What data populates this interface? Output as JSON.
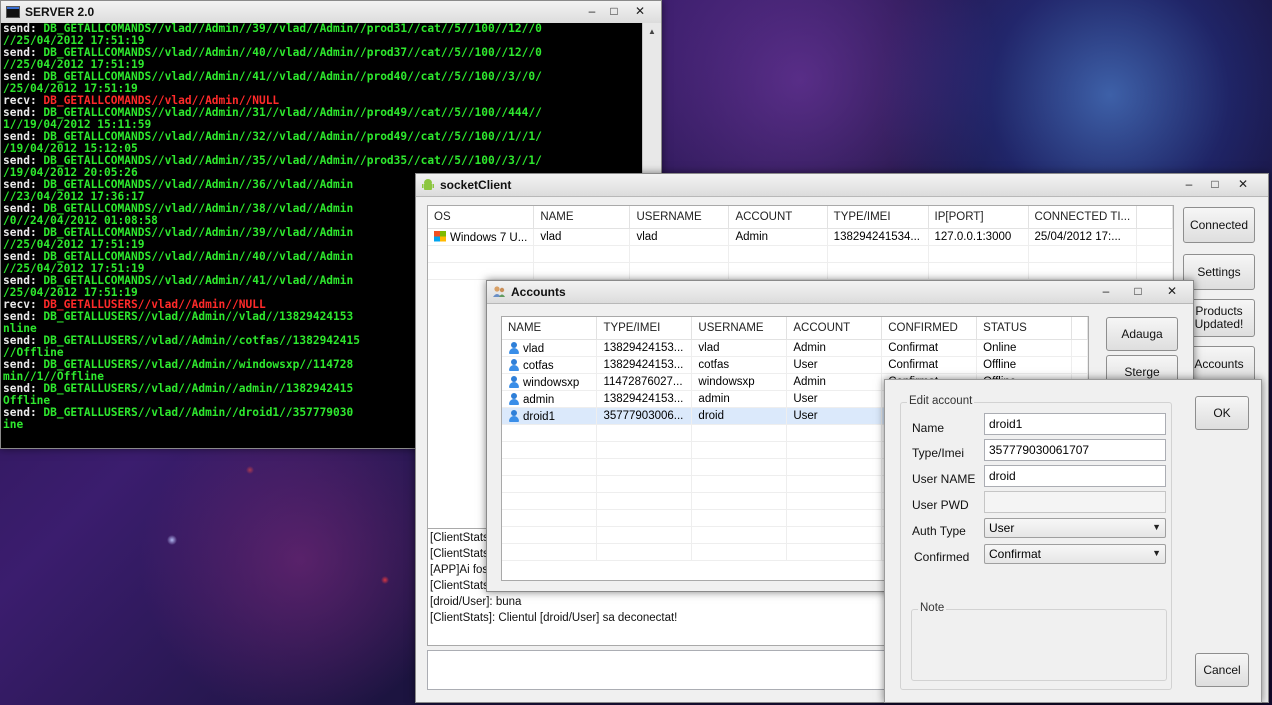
{
  "server": {
    "title": "SERVER 2.0",
    "lines": [
      {
        "lbl": "send:",
        "text": " DB_GETALLCOMANDS//vlad//Admin//39//vlad//Admin//prod31//cat//5//100//12//0",
        "kind": "green"
      },
      {
        "lbl": "",
        "text": "//25/04/2012 17:51:19",
        "kind": "green"
      },
      {
        "lbl": "send:",
        "text": " DB_GETALLCOMANDS//vlad//Admin//40//vlad//Admin//prod37//cat//5//100//12//0",
        "kind": "green"
      },
      {
        "lbl": "",
        "text": "//25/04/2012 17:51:19",
        "kind": "green"
      },
      {
        "lbl": "send:",
        "text": " DB_GETALLCOMANDS//vlad//Admin//41//vlad//Admin//prod40//cat//5//100//3//0/",
        "kind": "green"
      },
      {
        "lbl": "",
        "text": "/25/04/2012 17:51:19",
        "kind": "green"
      },
      {
        "lbl": "recv:",
        "text": " DB_GETALLCOMANDS//vlad//Admin//NULL",
        "kind": "red"
      },
      {
        "lbl": "send:",
        "text": " DB_GETALLCOMANDS//vlad//Admin//31//vlad//Admin//prod49//cat//5//100//444//",
        "kind": "green"
      },
      {
        "lbl": "",
        "text": "1//19/04/2012 15:11:59",
        "kind": "green"
      },
      {
        "lbl": "send:",
        "text": " DB_GETALLCOMANDS//vlad//Admin//32//vlad//Admin//prod49//cat//5//100//1//1/",
        "kind": "green"
      },
      {
        "lbl": "",
        "text": "/19/04/2012 15:12:05",
        "kind": "green"
      },
      {
        "lbl": "send:",
        "text": " DB_GETALLCOMANDS//vlad//Admin//35//vlad//Admin//prod35//cat//5//100//3//1/",
        "kind": "green"
      },
      {
        "lbl": "",
        "text": "/19/04/2012 20:05:26",
        "kind": "green"
      },
      {
        "lbl": "send:",
        "text": " DB_GETALLCOMANDS//vlad//Admin//36//vlad//Admin",
        "kind": "green"
      },
      {
        "lbl": "",
        "text": "//23/04/2012 17:36:17",
        "kind": "green"
      },
      {
        "lbl": "send:",
        "text": " DB_GETALLCOMANDS//vlad//Admin//38//vlad//Admin",
        "kind": "green"
      },
      {
        "lbl": "",
        "text": "/0//24/04/2012 01:08:58",
        "kind": "green"
      },
      {
        "lbl": "send:",
        "text": " DB_GETALLCOMANDS//vlad//Admin//39//vlad//Admin",
        "kind": "green"
      },
      {
        "lbl": "",
        "text": "//25/04/2012 17:51:19",
        "kind": "green"
      },
      {
        "lbl": "send:",
        "text": " DB_GETALLCOMANDS//vlad//Admin//40//vlad//Admin",
        "kind": "green"
      },
      {
        "lbl": "",
        "text": "//25/04/2012 17:51:19",
        "kind": "green"
      },
      {
        "lbl": "send:",
        "text": " DB_GETALLCOMANDS//vlad//Admin//41//vlad//Admin",
        "kind": "green"
      },
      {
        "lbl": "",
        "text": "/25/04/2012 17:51:19",
        "kind": "green"
      },
      {
        "lbl": "recv:",
        "text": " DB_GETALLUSERS//vlad//Admin//NULL",
        "kind": "red"
      },
      {
        "lbl": "send:",
        "text": " DB_GETALLUSERS//vlad//Admin//vlad//13829424153",
        "kind": "green"
      },
      {
        "lbl": "",
        "text": "nline",
        "kind": "green"
      },
      {
        "lbl": "send:",
        "text": " DB_GETALLUSERS//vlad//Admin//cotfas//1382942415",
        "kind": "green"
      },
      {
        "lbl": "",
        "text": "//Offline",
        "kind": "green"
      },
      {
        "lbl": "send:",
        "text": " DB_GETALLUSERS//vlad//Admin//windowsxp//114728",
        "kind": "green"
      },
      {
        "lbl": "",
        "text": "min//1//Offline",
        "kind": "green"
      },
      {
        "lbl": "send:",
        "text": " DB_GETALLUSERS//vlad//Admin//admin//1382942415",
        "kind": "green"
      },
      {
        "lbl": "",
        "text": "Offline",
        "kind": "green"
      },
      {
        "lbl": "send:",
        "text": " DB_GETALLUSERS//vlad//Admin//droid1//357779030",
        "kind": "green"
      },
      {
        "lbl": "",
        "text": "ine",
        "kind": "green"
      }
    ]
  },
  "client": {
    "title": "socketClient",
    "columns": [
      "OS",
      "NAME",
      "USERNAME",
      "ACCOUNT",
      "TYPE/IMEI",
      "IP[PORT]",
      "CONNECTED TI..."
    ],
    "rows": [
      [
        "Windows 7 U...",
        "vlad",
        "vlad",
        "Admin",
        "138294241534...",
        "127.0.0.1:3000",
        "25/04/2012 17:..."
      ]
    ],
    "buttons": {
      "connected": "Connected",
      "settings": "Settings",
      "products_updated": "Products Updated!",
      "accounts": "Accounts"
    },
    "log": [
      "[ClientStats]",
      "[ClientStats]",
      "[APP]Ai fost",
      "[ClientStats]",
      "[droid/User]: buna",
      "[ClientStats]: Clientul [droid/User] sa deconectat!"
    ]
  },
  "accounts": {
    "title": "Accounts",
    "columns": [
      "NAME",
      "TYPE/IMEI",
      "USERNAME",
      "ACCOUNT",
      "CONFIRMED",
      "STATUS"
    ],
    "rows": [
      [
        "vlad",
        "13829424153...",
        "vlad",
        "Admin",
        "Confirmat",
        "Online"
      ],
      [
        "cotfas",
        "13829424153...",
        "cotfas",
        "User",
        "Confirmat",
        "Offline"
      ],
      [
        "windowsxp",
        "11472876027...",
        "windowsxp",
        "Admin",
        "Confirmat",
        "Offline"
      ],
      [
        "admin",
        "13829424153...",
        "admin",
        "User",
        "Confirmat",
        "Offline"
      ],
      [
        "droid1",
        "35777903006...",
        "droid",
        "User",
        "Confirmat",
        "Offline"
      ]
    ],
    "selected_row": 4,
    "buttons": {
      "add": "Adauga",
      "delete": "Sterge"
    }
  },
  "edit": {
    "group_title": "Edit account",
    "fields": {
      "name_label": "Name",
      "name_value": "droid1",
      "imei_label": "Type/Imei",
      "imei_value": "357779030061707",
      "username_label": "User NAME",
      "username_value": "droid",
      "pwd_label": "User PWD",
      "pwd_value": "",
      "auth_label": "Auth Type",
      "auth_value": "User",
      "confirmed_label": "Confirmed",
      "confirmed_value": "Confirmat"
    },
    "note_title": "Note",
    "ok": "OK",
    "cancel": "Cancel"
  },
  "colors": {
    "console_green": "#2ee82e",
    "console_red": "#ff2a2a",
    "selection": "#dbe9fb"
  }
}
